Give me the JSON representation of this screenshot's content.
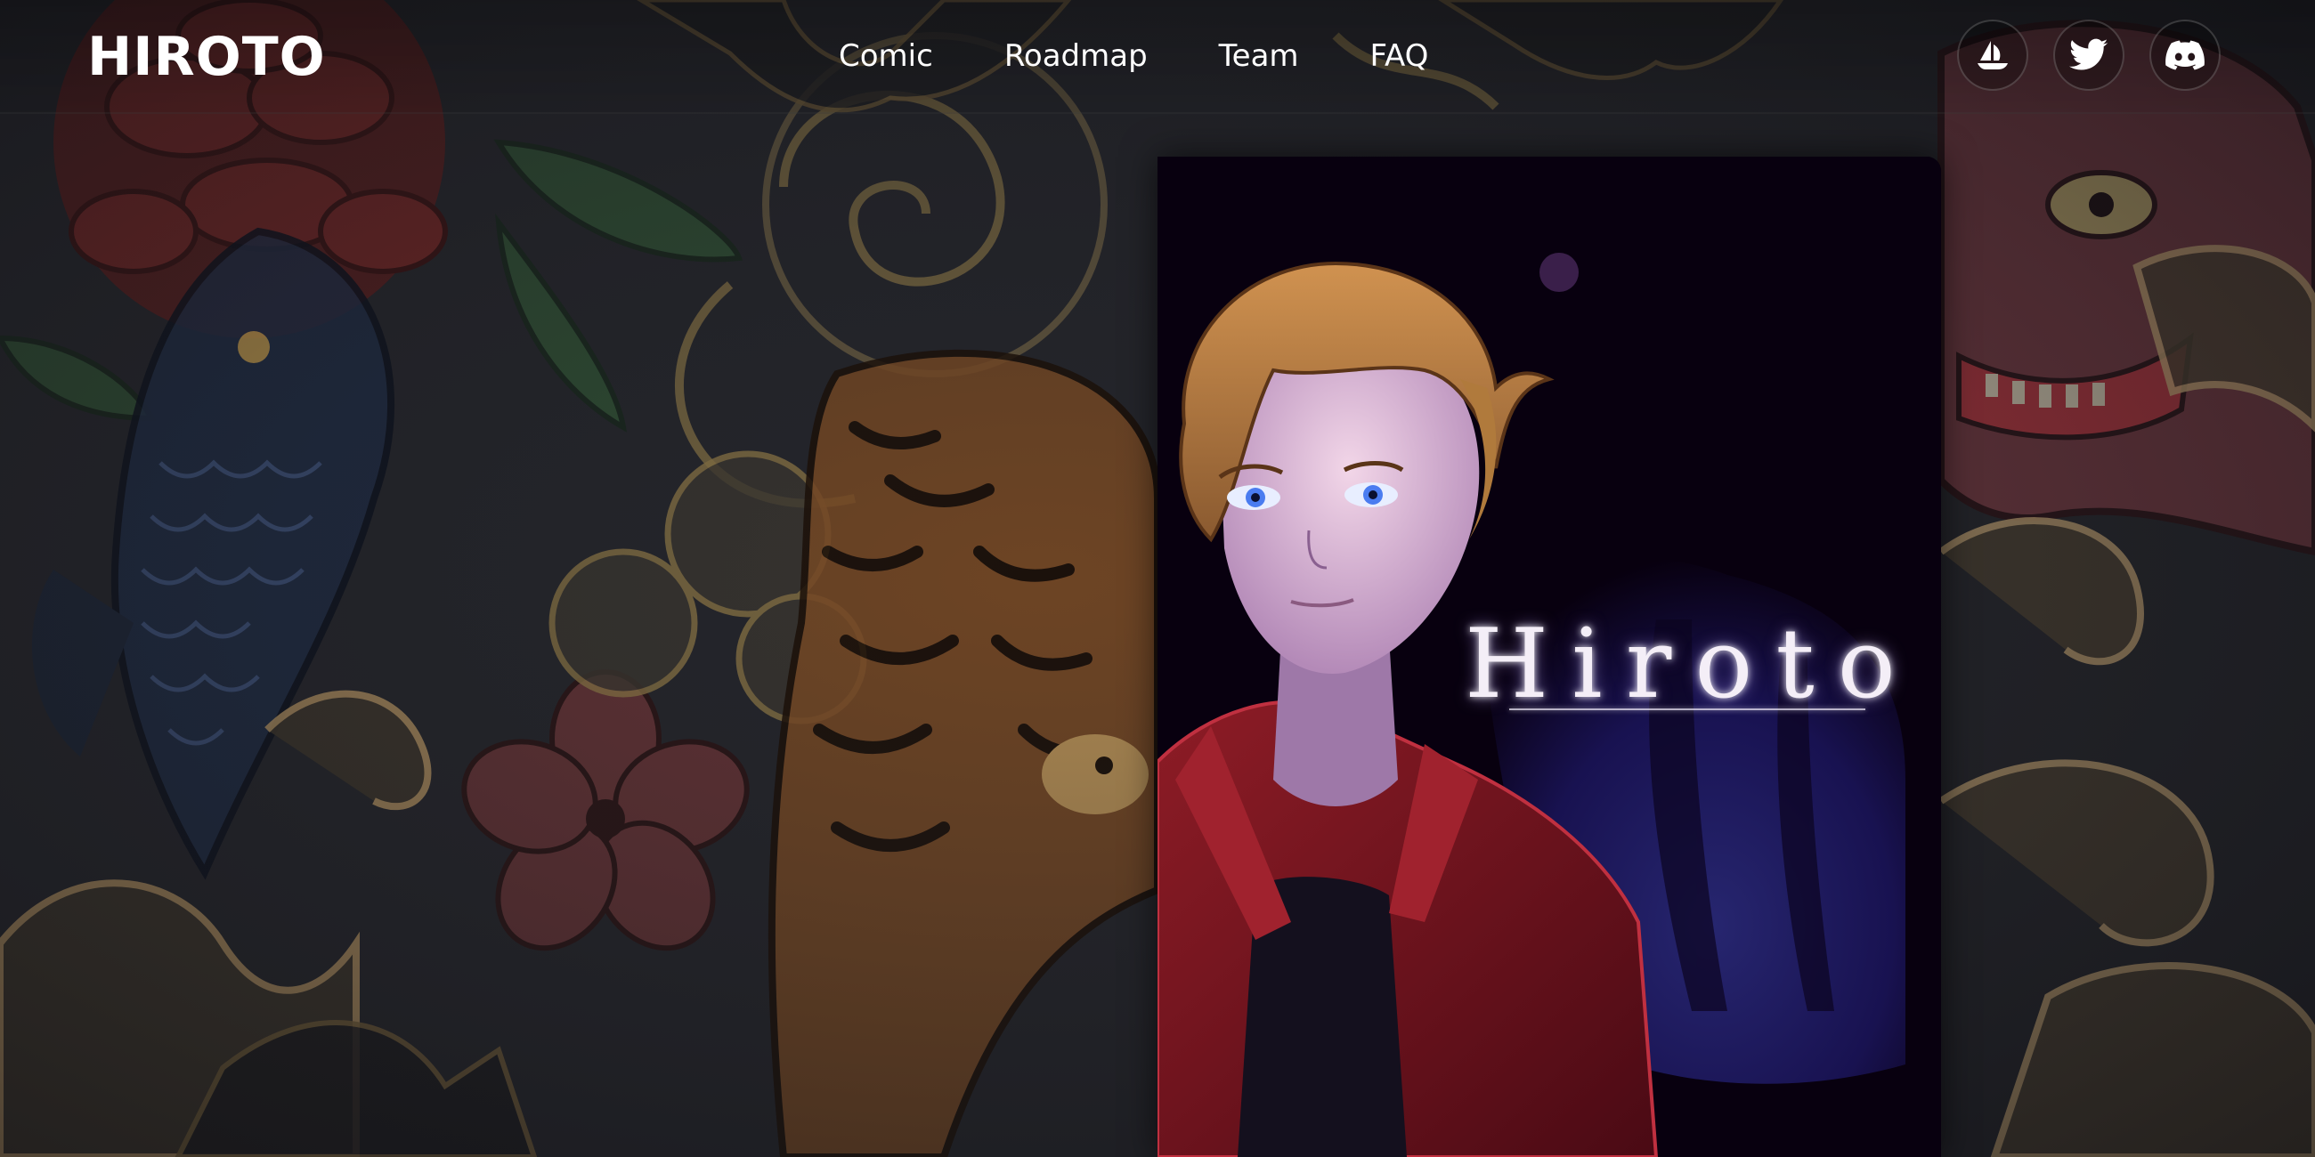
{
  "brand": {
    "logo_text": "HIROTO"
  },
  "nav": {
    "items": [
      {
        "label": "Comic"
      },
      {
        "label": "Roadmap"
      },
      {
        "label": "Team"
      },
      {
        "label": "FAQ"
      }
    ]
  },
  "socials": [
    {
      "name": "opensea",
      "icon": "sailboat-icon"
    },
    {
      "name": "twitter",
      "icon": "twitter-bird-icon"
    },
    {
      "name": "discord",
      "icon": "discord-icon"
    }
  ],
  "cover": {
    "title": "Hiroto"
  },
  "colors": {
    "background": "#1c1d22",
    "header_text": "#ffffff",
    "cover_background": "#08000f",
    "jacket_red": "#6e1420",
    "hair": "#b07a3c",
    "eyes": "#5a8cff"
  }
}
